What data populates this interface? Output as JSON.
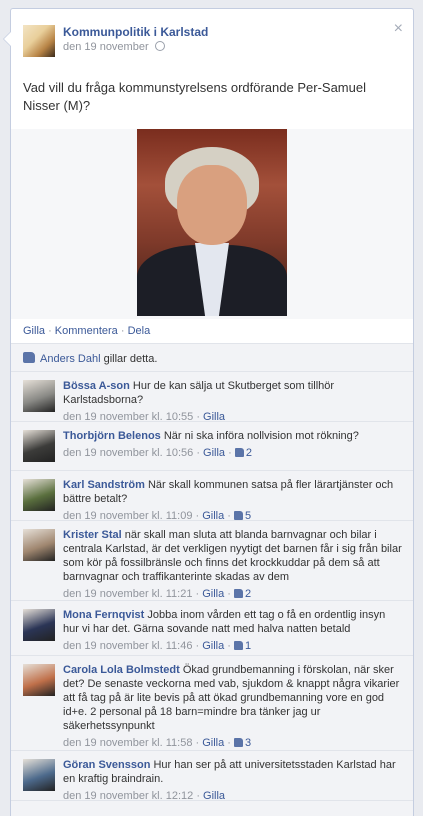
{
  "post": {
    "page_name": "Kommunpolitik i Karlstad",
    "date": "den 19 november",
    "text": "Vad vill du fråga kommunstyrelsens ordförande Per-Samuel Nisser (M)?",
    "close_glyph": "×",
    "actions": {
      "like": "Gilla",
      "comment": "Kommentera",
      "share": "Dela",
      "sep": " · "
    },
    "likes_line": {
      "name": "Anders Dahl",
      "text": " gillar detta."
    }
  },
  "comments": [
    {
      "name": "Bössa A-son",
      "text": "Hur de kan sälja ut Skutberget som tillhör Karlstadsborna?",
      "time": "den 19 november kl. 10:55",
      "like": "Gilla",
      "likes": "",
      "avatar": "#8a8a86"
    },
    {
      "name": "Thorbjörn Belenos",
      "text": "När ni ska införa nollvision mot rökning?",
      "time": "den 19 november kl. 10:56",
      "like": "Gilla",
      "likes": "2",
      "avatar": "#3c3c3a"
    },
    {
      "name": "Karl Sandström",
      "text": "När skall kommunen satsa på fler lärartjänster och bättre betalt?",
      "time": "den 19 november kl. 11:09",
      "like": "Gilla",
      "likes": "5",
      "avatar": "#5a6f3e"
    },
    {
      "name": "Krister Stal",
      "text": "när skall man sluta att blanda barnvagnar och bilar i centrala Karlstad, är det verkligen nyytigt det barnen får i sig från bilar som kör på fossilbränsle och finns det krockkuddar på dem så att barnvagnar och traffikanterinte skadas av dem",
      "time": "den 19 november kl. 11:21",
      "like": "Gilla",
      "likes": "2",
      "avatar": "#a08770"
    },
    {
      "name": "Mona Fernqvist",
      "text": "Jobba inom vården ett tag o få en ordentlig insyn hur vi har det. Gärna sovande natt med halva natten betald",
      "time": "den 19 november kl. 11:46",
      "like": "Gilla",
      "likes": "1",
      "avatar": "#2b3556"
    },
    {
      "name": "Carola Lola Bolmstedt",
      "text": "Ökad grundbemanning i förskolan, när sker det? De senaste veckorna med vab, sjukdom & knappt några vikarier att få tag på är lite bevis på att ökad grundbemanning vore en god id+e. 2 personal på 18 barn=mindre bra tänker jag ur säkerhetssynpunkt",
      "time": "den 19 november kl. 11:58",
      "like": "Gilla",
      "likes": "3",
      "avatar": "#c0704a"
    },
    {
      "name": "Göran Svensson",
      "text": "Hur han ser på att universitetsstaden Karlstad har en kraftig braindrain.",
      "time": "den 19 november kl. 12:12",
      "like": "Gilla",
      "likes": "",
      "avatar": "#4d6a8c"
    }
  ]
}
